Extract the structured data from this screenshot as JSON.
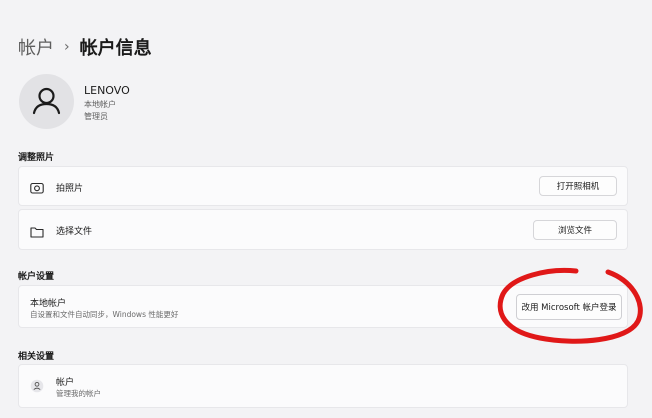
{
  "breadcrumb": {
    "parent": "帐户",
    "separator": "›",
    "current": "帐户信息"
  },
  "user": {
    "name": "LENOVO",
    "account_type": "本地帐户",
    "role": "管理员"
  },
  "photo_section": {
    "title": "调整照片",
    "take_photo": {
      "label": "拍照片",
      "button": "打开照相机"
    },
    "choose_file": {
      "label": "选择文件",
      "button": "浏览文件"
    }
  },
  "account_settings": {
    "title": "帐户设置",
    "local_account": {
      "label": "本地帐户",
      "description": "自设置和文件自动同步，Windows 性能更好",
      "button": "改用 Microsoft 帐户登录"
    }
  },
  "related_settings": {
    "title": "相关设置",
    "accounts": {
      "label": "帐户",
      "description": "管理我的帐户"
    }
  },
  "colors": {
    "annotation": "#e01818",
    "background": "#f3f3f5",
    "card": "#fbfbfc"
  }
}
